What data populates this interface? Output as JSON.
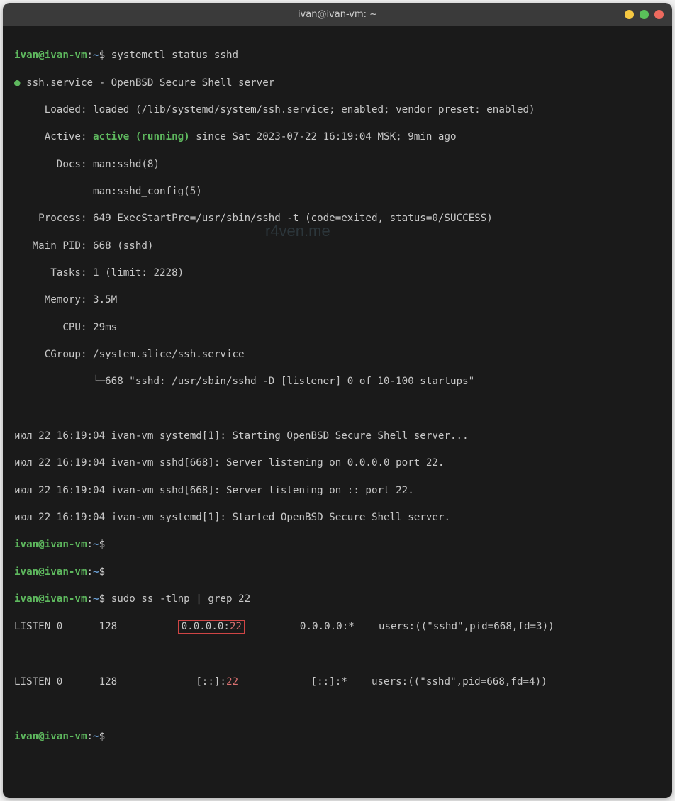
{
  "window": {
    "title": "ivan@ivan-vm: ~"
  },
  "prompt": {
    "user_host": "ivan@ivan-vm",
    "sep": ":",
    "path": "~",
    "symbol": "$"
  },
  "commands": {
    "cmd1": "systemctl status sshd",
    "cmd2": "sudo ss -tlnp | grep 22"
  },
  "status": {
    "bullet": "●",
    "service_line": " ssh.service - OpenBSD Secure Shell server",
    "loaded": "     Loaded: loaded (/lib/systemd/system/ssh.service; enabled; vendor preset: enabled)",
    "active_label": "     Active: ",
    "active_value": "active (running)",
    "active_rest": " since Sat 2023-07-22 16:19:04 MSK; 9min ago",
    "docs1": "       Docs: man:sshd(8)",
    "docs2": "             man:sshd_config(5)",
    "process": "    Process: 649 ExecStartPre=/usr/sbin/sshd -t (code=exited, status=0/SUCCESS)",
    "mainpid": "   Main PID: 668 (sshd)",
    "tasks": "      Tasks: 1 (limit: 2228)",
    "memory": "     Memory: 3.5M",
    "cpu": "        CPU: 29ms",
    "cgroup1": "     CGroup: /system.slice/ssh.service",
    "cgroup2": "             └─668 \"sshd: /usr/sbin/sshd -D [listener] 0 of 10-100 startups\""
  },
  "log": {
    "l1": "июл 22 16:19:04 ivan-vm systemd[1]: Starting OpenBSD Secure Shell server...",
    "l2": "июл 22 16:19:04 ivan-vm sshd[668]: Server listening on 0.0.0.0 port 22.",
    "l3": "июл 22 16:19:04 ivan-vm sshd[668]: Server listening on :: port 22.",
    "l4": "июл 22 16:19:04 ivan-vm systemd[1]: Started OpenBSD Secure Shell server."
  },
  "ss": {
    "row1_pre": "LISTEN 0      128          ",
    "row1_box_ip": "0.0.0.0:",
    "row1_box_port": "22",
    "row1_post": "         0.0.0.0:*    users:((\"sshd\",pid=668,fd=3))",
    "row2_pre": "LISTEN 0      128             ",
    "row2_ip": "[::]:",
    "row2_port": "22",
    "row2_post": "            [::]:*    users:((\"sshd\",pid=668,fd=4))"
  },
  "watermark": "r4ven.me"
}
